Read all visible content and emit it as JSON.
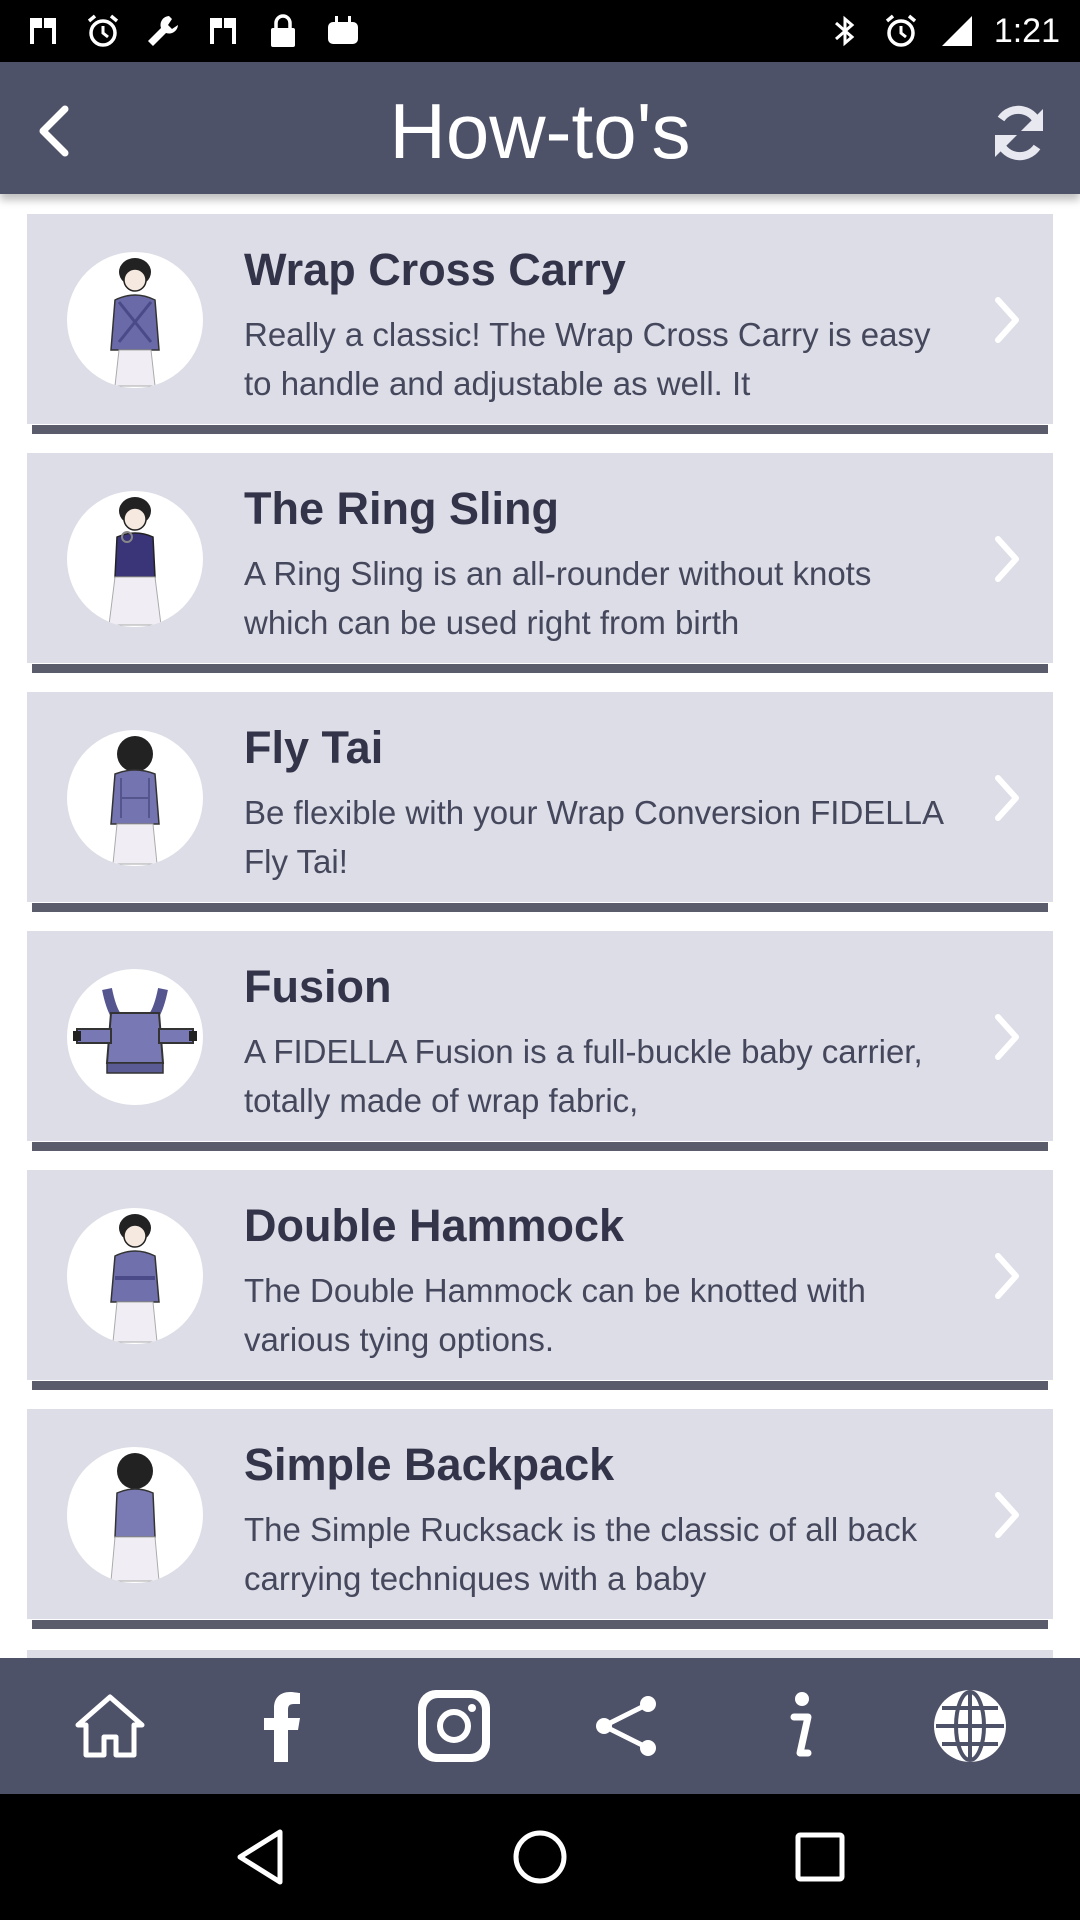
{
  "status_bar": {
    "time": "1:21",
    "left_icons": [
      "bill-icon",
      "alarm-clock-icon",
      "wrench-icon",
      "bill-icon",
      "lock-icon",
      "android-icon"
    ],
    "right_icons": [
      "bluetooth-icon",
      "alarm-clock-icon",
      "signal-icon"
    ]
  },
  "header": {
    "title": "How-to's",
    "back_icon": "chevron-left-icon",
    "refresh_icon": "refresh-icon"
  },
  "items": [
    {
      "title": "Wrap Cross Carry",
      "description": "Really a classic! The Wrap Cross Carry is easy to handle and adjustable as well. It"
    },
    {
      "title": "The Ring Sling",
      "description": "A Ring Sling is an all-rounder without knots which can be used right from birth"
    },
    {
      "title": "Fly Tai",
      "description": "Be flexible with your Wrap Conversion FIDELLA Fly Tai!"
    },
    {
      "title": "Fusion",
      "description": "A FIDELLA Fusion is a full-buckle baby carrier, totally made of wrap fabric,"
    },
    {
      "title": "Double Hammock",
      "description": "The Double Hammock can be knotted with various tying options."
    },
    {
      "title": "Simple Backpack",
      "description": "The Simple Rucksack is the classic of all back carrying techniques with a baby"
    }
  ],
  "toolbar": [
    "home-icon",
    "facebook-icon",
    "instagram-icon",
    "share-icon",
    "info-icon",
    "globe-icon"
  ],
  "colors": {
    "header_bg": "#4e5268",
    "item_bg": "#dcdde6",
    "title_text": "#33344a",
    "carrier_purple": "#6a6aa8"
  }
}
